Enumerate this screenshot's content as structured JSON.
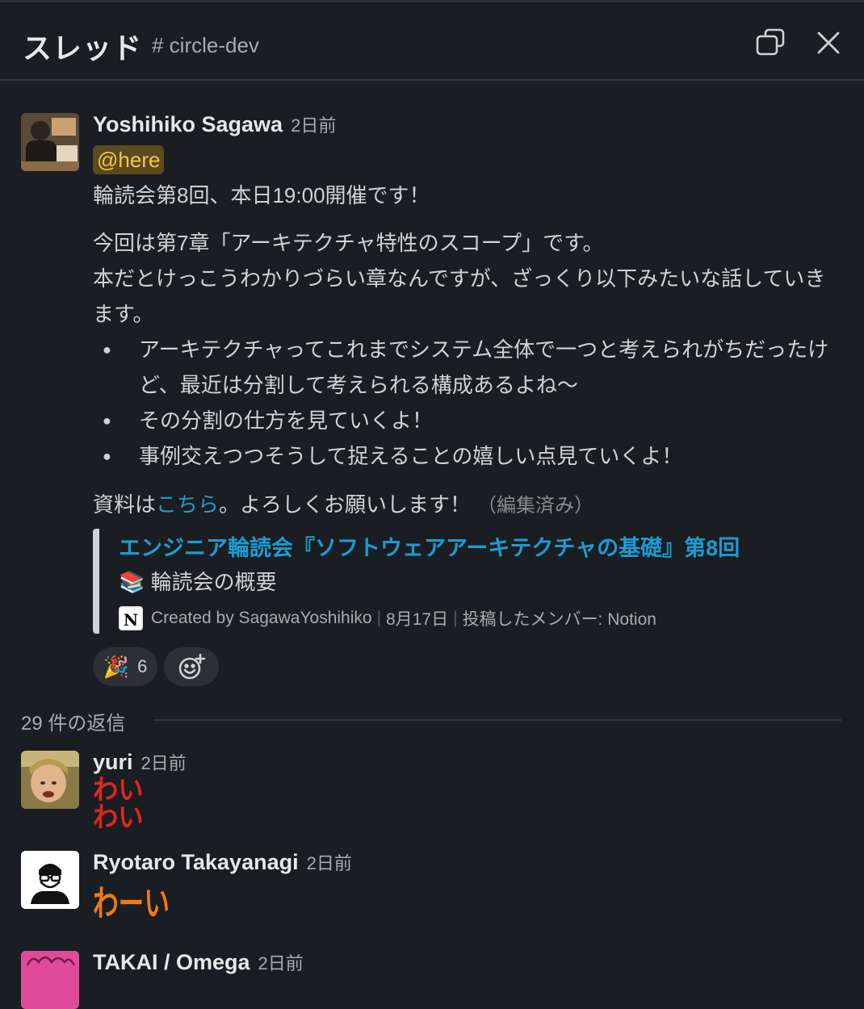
{
  "header": {
    "title": "スレッド",
    "channel": "# circle-dev"
  },
  "parent": {
    "author": "Yoshihiko Sagawa",
    "time": "2日前",
    "mention": "@here",
    "line1": "輪読会第8回、本日19:00開催です！",
    "para1": "今回は第7章「アーキテクチャ特性のスコープ」です。",
    "para2": "本だとけっこうわかりづらい章なんですが、ざっくり以下みたいな話していきます。",
    "bullets": [
      "アーキテクチャってこれまでシステム全体で一つと考えられがちだったけど、最近は分割して考えられる構成あるよね〜",
      "その分割の仕方を見ていくよ！",
      "事例交えつつそうして捉えることの嬉しい点見ていくよ！"
    ],
    "resources_prefix": "資料は",
    "resources_link": "こちら",
    "resources_suffix": "。よろしくお願いします！",
    "edited": "（編集済み）",
    "unfurl": {
      "title": "エンジニア輪読会『ソフトウェアアーキテクチャの基礎』第8回",
      "desc_emoji": "📚",
      "desc": "輪読会の概要",
      "created_by": "Created by SagawaYoshihiko",
      "date": "8月17日",
      "posted_by": "投稿したメンバー: Notion"
    },
    "reactions": [
      {
        "emoji": "🎉",
        "count": "6"
      }
    ]
  },
  "replies_label": "29 件の返信",
  "replies": [
    {
      "author": "yuri",
      "time": "2日前",
      "stamp": "わい\nわい"
    },
    {
      "author": "Ryotaro Takayanagi",
      "time": "2日前",
      "stamp": "わーい"
    },
    {
      "author": "TAKAI / Omega",
      "time": "2日前"
    }
  ],
  "colors": {
    "background": "#1a1d21",
    "link": "#1d9bd1",
    "mention_bg": "#5c4a1f",
    "mention_fg": "#f2c744"
  }
}
